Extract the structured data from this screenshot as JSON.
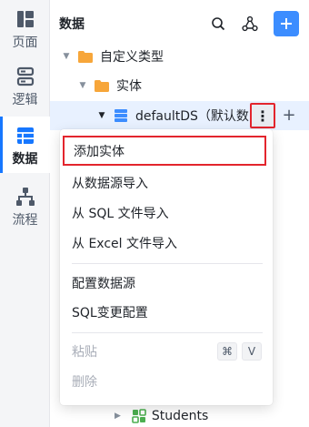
{
  "rail": {
    "items": [
      {
        "label": "页面",
        "icon": "page-icon"
      },
      {
        "label": "逻辑",
        "icon": "logic-icon"
      },
      {
        "label": "数据",
        "icon": "data-icon",
        "active": true
      },
      {
        "label": "流程",
        "icon": "flow-icon"
      }
    ]
  },
  "panel": {
    "title": "数据"
  },
  "tree": {
    "custom_types": "自定义类型",
    "entities": "实体",
    "datasource": "defaultDS（默认数",
    "students": "Students"
  },
  "menu": {
    "items": [
      {
        "label": "添加实体"
      },
      {
        "label": "从数据源导入"
      },
      {
        "label": "从 SQL 文件导入"
      },
      {
        "label": "从 Excel 文件导入"
      },
      {
        "label": "配置数据源"
      },
      {
        "label": "SQL变更配置"
      },
      {
        "label": "粘贴",
        "shortcut_mod": "⌘",
        "shortcut_key": "V",
        "disabled": true
      },
      {
        "label": "删除",
        "disabled": true
      }
    ]
  },
  "colors": {
    "accent": "#3c8dff",
    "folder": "#f7a63a",
    "highlight_border": "#e3252d",
    "datasource": "#3c8dff",
    "entity_green": "#4caf50"
  }
}
